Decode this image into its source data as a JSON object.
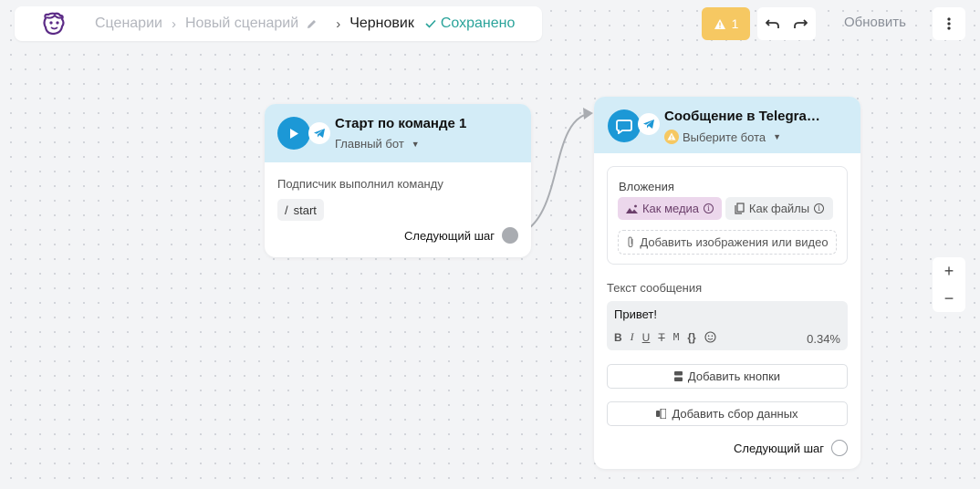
{
  "breadcrumb": {
    "scenarios": "Сценарии",
    "new_scenario": "Новый сценарий",
    "draft": "Черновик",
    "saved": "Сохранено"
  },
  "toolbar": {
    "warnings_count": "1",
    "refresh_label": "Обновить"
  },
  "zoom": {
    "plus": "+",
    "minus": "−"
  },
  "node_start": {
    "title": "Старт по команде 1",
    "bot": "Главный бот",
    "trigger_text": "Подписчик выполнил команду",
    "command_prefix": "/",
    "command": "start",
    "next_step": "Следующий шаг"
  },
  "node_message": {
    "title": "Сообщение в Telegra…",
    "bot_placeholder": "Выберите бота",
    "attachments_label": "Вложения",
    "as_media": "Как медиа",
    "as_files": "Как файлы",
    "add_media": "Добавить изображения или видео",
    "message_label": "Текст сообщения",
    "message_text": "Привет!",
    "format_buttons": [
      "B",
      "I",
      "U",
      "T",
      "M",
      "{}"
    ],
    "percent": "0.34%",
    "add_buttons": "Добавить кнопки",
    "add_data_collection": "Добавить сбор данных",
    "next_step": "Следующий шаг"
  },
  "colors": {
    "node_header": "#d3ecf7",
    "telegram_blue": "#1c98d6",
    "saved_green": "#2aa39a",
    "warning_yellow": "#f6c862",
    "media_pink": "#ecd7ec"
  }
}
